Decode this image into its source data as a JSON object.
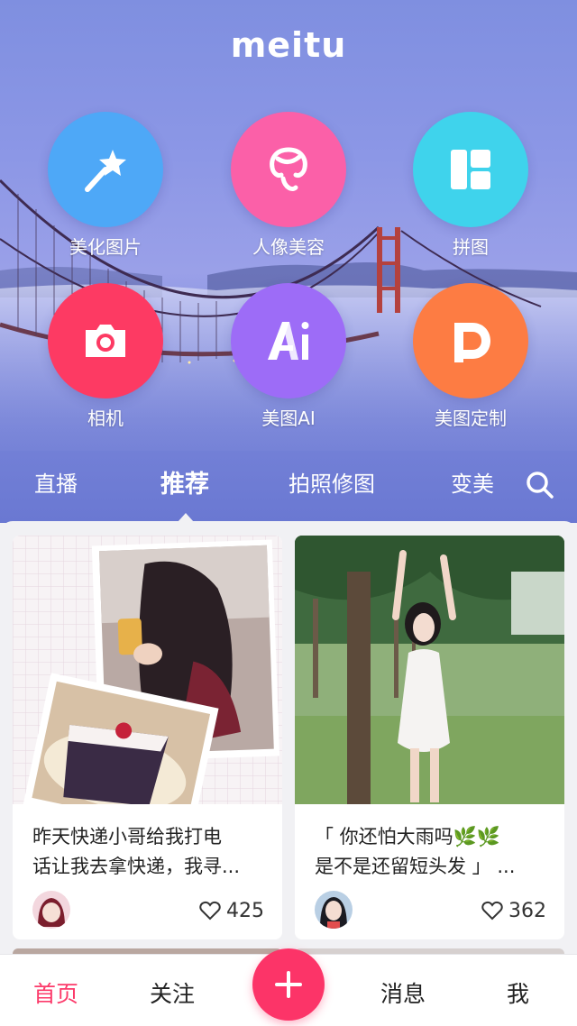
{
  "app": {
    "logo": "meitu"
  },
  "tools": [
    {
      "label": "美化图片",
      "icon": "magic-wand-icon",
      "color": "#4ea8f7"
    },
    {
      "label": "人像美容",
      "icon": "portrait-face-icon",
      "color": "#fb60a8"
    },
    {
      "label": "拼图",
      "icon": "collage-grid-icon",
      "color": "#3fd3ec"
    },
    {
      "label": "相机",
      "icon": "camera-icon",
      "color": "#fd3a63"
    },
    {
      "label": "美图AI",
      "icon": "ai-icon",
      "color": "#9d6cf7"
    },
    {
      "label": "美图定制",
      "icon": "custom-print-icon",
      "color": "#fd7c43"
    }
  ],
  "tabs": [
    {
      "label": "直播",
      "active": false
    },
    {
      "label": "推荐",
      "active": true
    },
    {
      "label": "拍照修图",
      "active": false
    },
    {
      "label": "变美",
      "active": false
    }
  ],
  "search": {
    "icon": "search-icon"
  },
  "feed": [
    {
      "caption_line1": "昨天快递小哥给我打电",
      "caption_line2": "话让我去拿快递，我寻...",
      "likes": "425",
      "avatar": "anime-avatar"
    },
    {
      "caption_line1": "「 你还怕大雨吗🌿🌿",
      "caption_line2": "是不是还留短头发 」 ...",
      "likes": "362",
      "avatar": "user-avatar"
    }
  ],
  "bottom_nav": [
    {
      "label": "首页",
      "active": true
    },
    {
      "label": "关注",
      "active": false
    },
    {
      "label": "消息",
      "active": false
    },
    {
      "label": "我",
      "active": false
    }
  ],
  "fab": {
    "icon": "plus-icon",
    "color": "#fc3468"
  },
  "colors": {
    "accent": "#fc3a6a",
    "hero": "#8c97e6"
  }
}
